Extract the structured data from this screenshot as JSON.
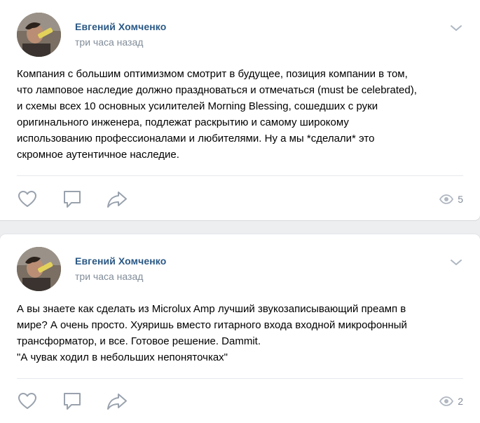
{
  "posts": [
    {
      "author": "Евгений Хомченко",
      "time": "три часа назад",
      "text_lines": [
        "Компания с большим оптимизмом смотрит в будущее, позиция компании в том,",
        "что ламповое наследие должно праздноваться и отмечаться (must be celebrated),",
        "и схемы всех 10 основных усилителей Morning Blessing, сошедших с руки",
        "оригинального инженера, подлежат раскрытию и самому широкому",
        "использованию профессионалами и любителями. Ну а мы *сделали* это",
        "скромное аутентичное наследие."
      ],
      "views": "5"
    },
    {
      "author": "Евгений Хомченко",
      "time": "три часа назад",
      "text_lines": [
        "А вы знаете как сделать из Microlux Amp лучший звукозаписывающий преамп в",
        "мире? А очень просто. Хуяришь вместо гитарного входа входной микрофонный",
        "трансформатор, и все. Готовое решение. Dammit.",
        "\"А чувак ходил в небольших непоняточках\""
      ],
      "views": "2"
    }
  ],
  "icons": {
    "like": "heart-icon",
    "comment": "comment-icon",
    "share": "share-icon",
    "views": "eye-icon",
    "menu": "chevron-down-icon"
  },
  "colors": {
    "author": "#2a5885",
    "muted": "#818c99",
    "icon": "#99a2ad",
    "background": "#edeef0"
  }
}
